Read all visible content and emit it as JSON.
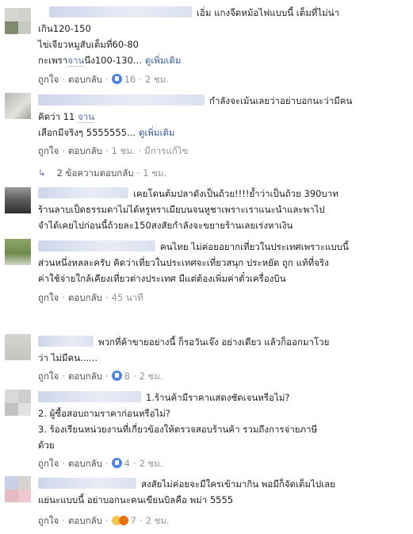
{
  "action_labels": {
    "like": "ถูกใจ",
    "reply": "ตอบกลับ"
  },
  "comments": [
    {
      "lines": [
        "เอิ่ม แกงจืดหม้อไฟแบบนี้ เต็มที่ไม่น่า",
        "เกิน120-150",
        "ไข่เจียวหมูสับเต็มที่60-80"
      ],
      "line4_before": "กะเพรา",
      "line4_highlight": "จาน",
      "line4_after": "นึง100-130...",
      "see_more": "ดูเพิ่มเติม",
      "reactions": "16",
      "time": "2 ชม."
    },
    {
      "line1": "กำลังจะเม้นเลยว่าอย่าบอกนะว่ามีคน",
      "line2_before": "คิดว่า 11 ",
      "line2_highlight": "จาน",
      "line3": "เสือกมีจริงๆ 5555555...",
      "see_more": "ดูเพิ่มเติม",
      "time": "1 ชม.",
      "edited": "มีการแก้ไข",
      "replies_label": "2 ข้อความตอบกลับ",
      "replies_time": "1 ชม."
    },
    {
      "lines": [
        "เคยโดนต้มปลาดังเป็นถ้วย!!!!ย้ำว่าเป็นถ้วย 390บาท",
        "ร้านลาบเป็ดธรรมดาไม่ได้หรูหราเมียบนจนหูชาเพราะเราแนะนำและพาไป",
        "จำได้เคยไปก่อนนี้ถ้วยละ150สงสัยกำลังจะขยายร้านเลยเร่งหาเงิน"
      ]
    },
    {
      "lines": [
        "คนไทย ไม่ค่อยอยากเที่ยวในประเทศเพราะแบบนี้",
        "ส่วนหนึ่งหลละครับ คิดว่าเที่ยวในประเทศจะเที่ยวสนุก ประหยัด ถูก แท้ที่จริง",
        "ค่าใช้จ่ายใกล้เคียงเที่ยวต่างประเทศ มีแต่ต้องเพิ่มค่าตั๋วเครื่องบิน"
      ],
      "time": "45 นาที"
    },
    {
      "lines": [
        "พวกที่ค้าขายอย่างนี้ ก็รอวันเจ๊ง อย่างเดียว แล้วก็ออกมาโวย",
        "ว่า ไม่มีคน......"
      ],
      "reactions": "8",
      "time": "2 ชม."
    },
    {
      "lines": [
        "1.ร้านค้ามีราคาแสดงชัดเจนหรือไม่?",
        "2. ผู้ซื้อสอบถามราคาก่อนหรือไม่?",
        "3. ร้องเรียนหน่วยงานที่เกี่ยวข้องให้ตรวจสอบร้านค้า รวมถึงการจ่ายภาษี",
        "ด้วย"
      ],
      "reactions": "4",
      "time": "2 ชม."
    },
    {
      "lines": [
        "สงสัยไม่ค่อยจะมีใครเข้ามากิน พอมีก็จัดเต็มไปเลย",
        "แย่นะแบบนี้ อย่าบอกนะคนเขียนบิลคือ พม่า 5555"
      ],
      "reactions": "7",
      "time": "2 ชม."
    }
  ]
}
